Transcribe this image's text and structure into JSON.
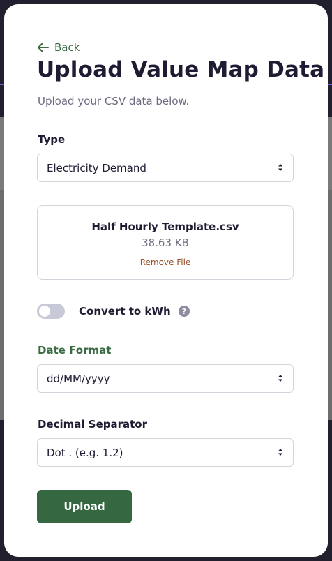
{
  "modal": {
    "back_label": "Back",
    "title": "Upload Value Map Data",
    "subtitle": "Upload your CSV data below."
  },
  "type_field": {
    "label": "Type",
    "value": "Electricity Demand"
  },
  "file": {
    "name": "Half Hourly Template.csv",
    "size": "38.63 KB",
    "remove_label": "Remove File"
  },
  "convert_toggle": {
    "label": "Convert to kWh",
    "enabled": false,
    "help": "?"
  },
  "date_format": {
    "label": "Date Format",
    "value": "dd/MM/yyyy"
  },
  "decimal_separator": {
    "label": "Decimal Separator",
    "value": "Dot . (e.g. 1.2)"
  },
  "actions": {
    "upload_label": "Upload"
  },
  "colors": {
    "accent": "#356840",
    "label_green": "#3a6b42",
    "remove": "#9a4f2b",
    "text": "#1e1b33"
  }
}
